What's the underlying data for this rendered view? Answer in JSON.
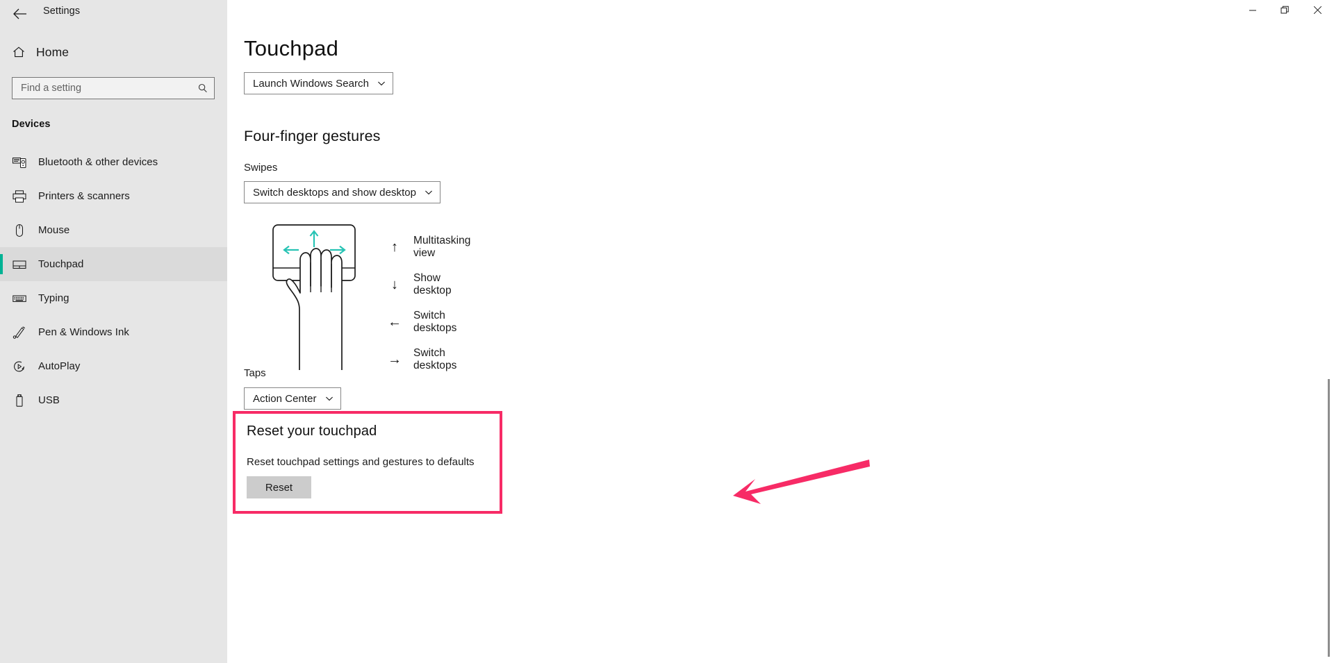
{
  "window": {
    "title": "Settings",
    "back_icon": "back-arrow-icon",
    "controls": {
      "minimize": "minimize-icon",
      "maximize": "restore-icon",
      "close": "close-icon"
    }
  },
  "sidebar": {
    "home": {
      "label": "Home",
      "icon": "home-icon"
    },
    "search": {
      "placeholder": "Find a setting",
      "value": "",
      "icon": "search-icon"
    },
    "section_title": "Devices",
    "items": [
      {
        "label": "Bluetooth & other devices",
        "icon": "bluetooth-devices-icon",
        "active": false
      },
      {
        "label": "Printers & scanners",
        "icon": "printer-icon",
        "active": false
      },
      {
        "label": "Mouse",
        "icon": "mouse-icon",
        "active": false
      },
      {
        "label": "Touchpad",
        "icon": "touchpad-icon",
        "active": true
      },
      {
        "label": "Typing",
        "icon": "keyboard-icon",
        "active": false
      },
      {
        "label": "Pen & Windows Ink",
        "icon": "pen-icon",
        "active": false
      },
      {
        "label": "AutoPlay",
        "icon": "autoplay-icon",
        "active": false
      },
      {
        "label": "USB",
        "icon": "usb-icon",
        "active": false
      }
    ]
  },
  "main": {
    "page_title": "Touchpad",
    "top_dropdown": {
      "value": "Launch Windows Search",
      "chevron": "chevron-down-icon"
    },
    "four_finger": {
      "heading": "Four-finger gestures",
      "swipes_label": "Swipes",
      "swipes_dropdown": {
        "value": "Switch desktops and show desktop",
        "chevron": "chevron-down-icon"
      },
      "illustration": "four-finger-touchpad-hand-illustration",
      "gestures": [
        {
          "direction": "up",
          "icon": "arrow-up-icon",
          "glyph": "↑",
          "label": "Multitasking view"
        },
        {
          "direction": "down",
          "icon": "arrow-down-icon",
          "glyph": "↓",
          "label": "Show desktop"
        },
        {
          "direction": "left",
          "icon": "arrow-left-icon",
          "glyph": "←",
          "label": "Switch desktops"
        },
        {
          "direction": "right",
          "icon": "arrow-right-icon",
          "glyph": "→",
          "label": "Switch desktops"
        }
      ],
      "taps_label": "Taps",
      "taps_dropdown": {
        "value": "Action Center",
        "chevron": "chevron-down-icon"
      }
    },
    "reset": {
      "heading": "Reset your touchpad",
      "description": "Reset touchpad settings and gestures to defaults",
      "button_label": "Reset"
    }
  },
  "annotations": {
    "highlight_color": "#f72b66",
    "arrow": "pink-pointer-arrow",
    "accent_color": "#00b294",
    "illustration_arrow_color": "#27c3b4"
  }
}
